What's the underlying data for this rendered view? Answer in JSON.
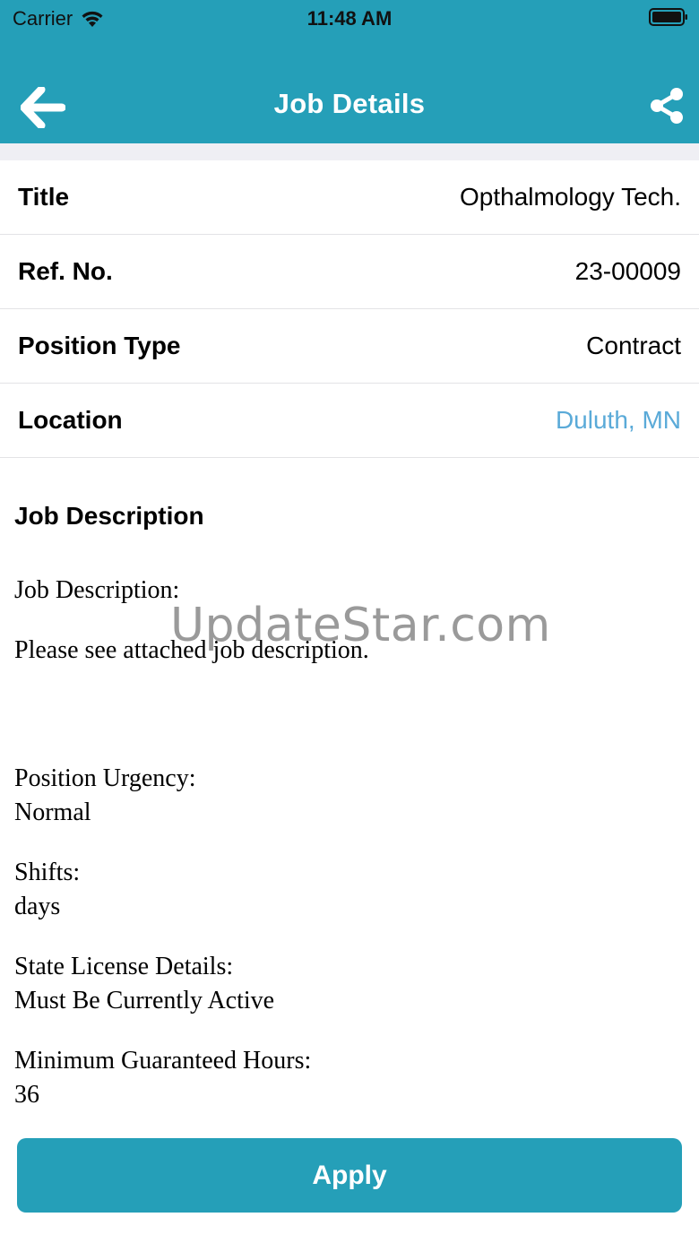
{
  "status_bar": {
    "carrier": "Carrier",
    "time": "11:48 AM"
  },
  "nav": {
    "title": "Job Details",
    "back_icon": "arrow-left-icon",
    "share_icon": "share-icon"
  },
  "details": {
    "title_label": "Title",
    "title_value": "Opthalmology Tech.",
    "ref_label": "Ref. No.",
    "ref_value": "23-00009",
    "position_type_label": "Position Type",
    "position_type_value": "Contract",
    "location_label": "Location",
    "location_value": "Duluth, MN"
  },
  "description": {
    "heading": "Job Description",
    "job_desc_label": "Job Description:",
    "job_desc_text": "Please see attached job description.",
    "urgency_label": "Position Urgency:",
    "urgency_value": "Normal",
    "shifts_label": "Shifts:",
    "shifts_value": "days",
    "license_label": "State License Details:",
    "license_value": "Must Be Currently Active",
    "min_hours_label": "Minimum Guaranteed Hours:",
    "min_hours_value": "36"
  },
  "watermark": "UpdateStar.com",
  "apply_label": "Apply",
  "colors": {
    "brand": "#259fb8",
    "link": "#5aaad8"
  }
}
